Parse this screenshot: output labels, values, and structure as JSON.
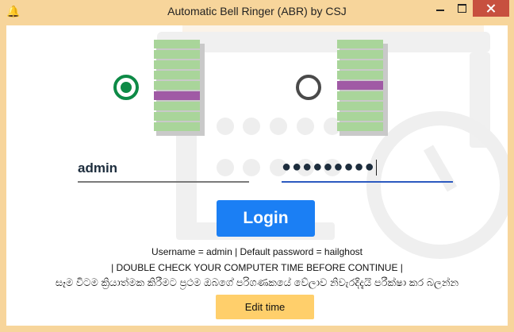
{
  "window": {
    "title": "Automatic Bell Ringer (ABR) by CSJ",
    "icon": "bell-icon"
  },
  "devices": [
    {
      "selected": true,
      "bars": 9,
      "active_bar_index": 5
    },
    {
      "selected": false,
      "bars": 9,
      "active_bar_index": 4
    }
  ],
  "login": {
    "username_value": "admin",
    "password_value": "●●●●●●●●●",
    "button_label": "Login"
  },
  "hints": {
    "credentials": "Username = admin | Default password = hailghost",
    "warning": "| DOUBLE CHECK YOUR COMPUTER TIME BEFORE CONTINUE |",
    "warning_si": "සෑම විටම ක්‍රියාත්මක කිරීමට ප්‍රථම ඔබගේ පරිගණකයේ වේලාව නිවැරදිදැයි පරීක්ෂා කර බලන්න"
  },
  "edit_time_label": "Edit time",
  "colors": {
    "titlebar": "#f7d59b",
    "close": "#c7503f",
    "login_button": "#1b7ff4",
    "edit_button": "#ffcf6b",
    "bar": "#a9d59a",
    "bar_active": "#a05aa5",
    "radio_selected": "#0d8a46"
  }
}
